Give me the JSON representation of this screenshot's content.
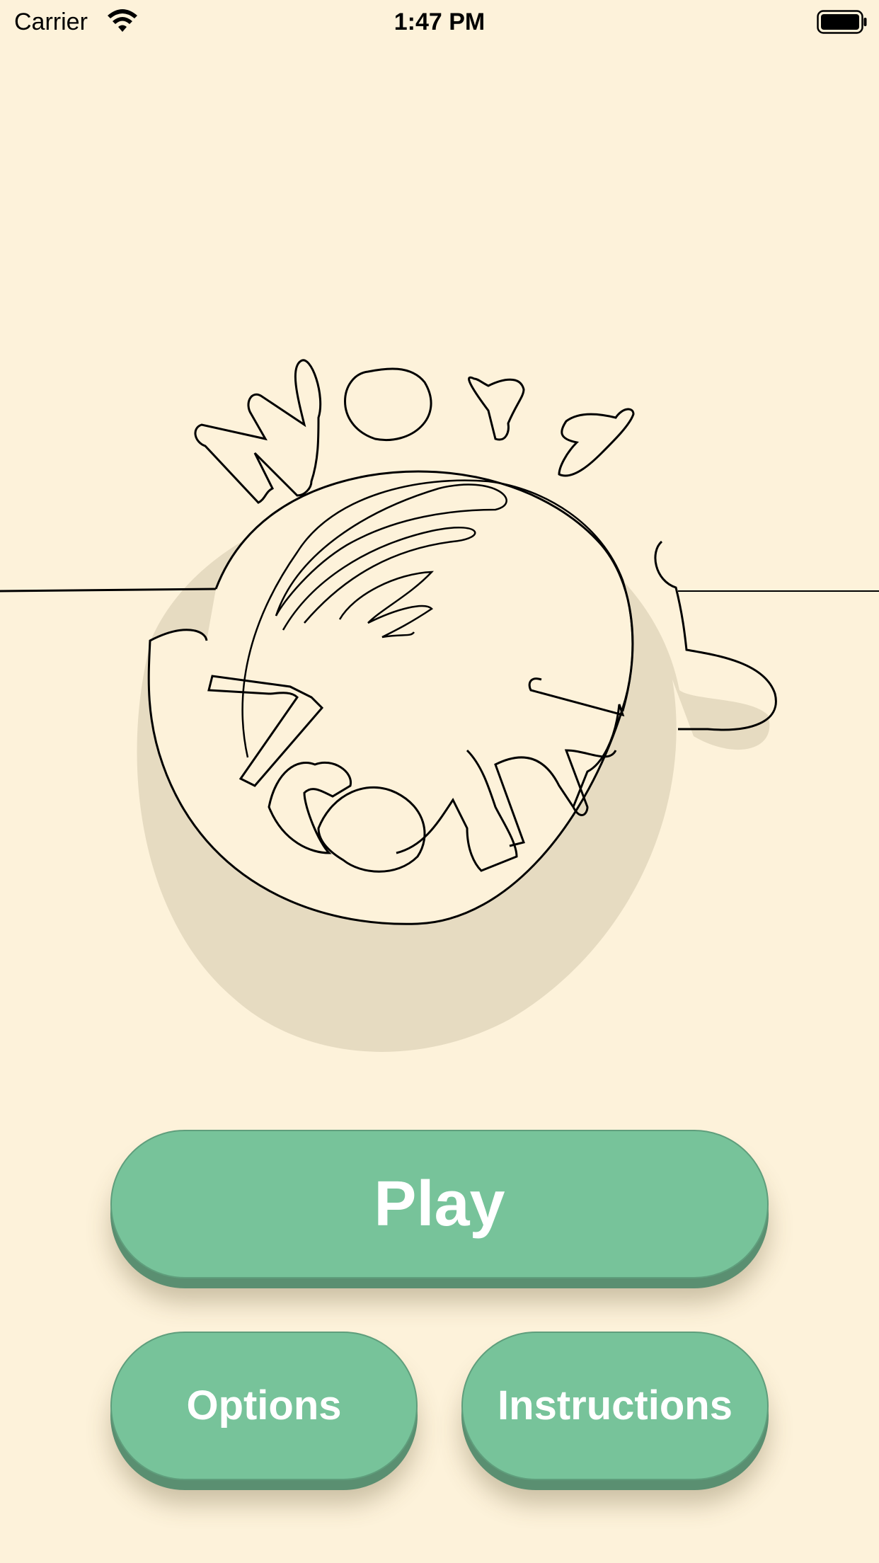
{
  "status_bar": {
    "carrier": "Carrier",
    "time": "1:47 PM",
    "icons": [
      "wifi-icon",
      "battery-icon"
    ]
  },
  "logo": {
    "text_line1": "Word",
    "text_line2": "Around",
    "style": "hand-drawn outline lettering around a circle with shadow"
  },
  "buttons": {
    "play": "Play",
    "options": "Options",
    "instructions": "Instructions"
  },
  "colors": {
    "background": "#fdf2da",
    "button": "#77c39a",
    "button_shadow": "#5a8f71",
    "logo_shadow": "#e6dbc1",
    "logo_stroke": "#000000",
    "button_text": "#ffffff"
  }
}
